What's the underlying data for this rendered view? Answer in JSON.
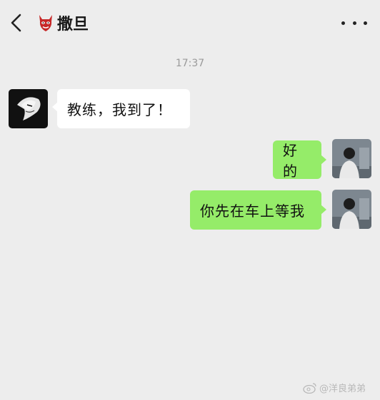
{
  "header": {
    "title": "撒旦",
    "back_icon": "chevron-left-icon",
    "title_emoji": "devil-mask-icon",
    "more_icon": "more-horizontal-icon"
  },
  "chat": {
    "timestamp": "17:37",
    "messages": [
      {
        "side": "left",
        "text": "教练，我到了！"
      },
      {
        "side": "right",
        "text": "好的"
      },
      {
        "side": "right",
        "text": "你先在车上等我"
      }
    ]
  },
  "colors": {
    "background": "#ededed",
    "own_bubble": "#95ec69",
    "other_bubble": "#ffffff"
  },
  "watermark": {
    "text": "@洋良弟弟"
  }
}
